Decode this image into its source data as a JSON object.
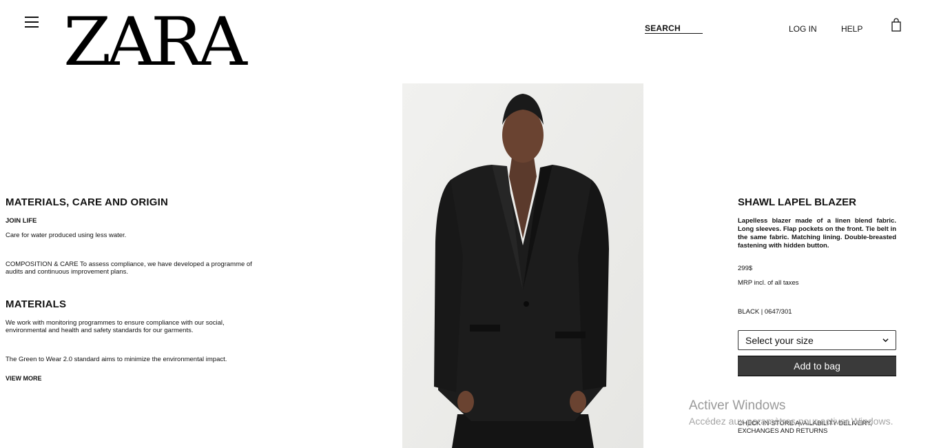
{
  "header": {
    "logo_text": "ZARA",
    "search_label": "SEARCH",
    "login_label": "LOG IN",
    "help_label": "HELP",
    "icons": {
      "menu": "menu-icon",
      "bag": "shopping-bag-icon"
    }
  },
  "left": {
    "section1_title": "MATERIALS, CARE AND ORIGIN",
    "join_life": "JOIN LIFE",
    "care_water": "Care for water produced using less water.",
    "composition_line1": "COMPOSITION & CARE To assess compliance, we have developed a programme of",
    "composition_line2": "audits and continuous improvement plans.",
    "section2_title": "MATERIALS",
    "monitoring_line1": "We work with monitoring programmes to ensure compliance with our social,",
    "monitoring_line2": "environmental and health and safety standards for our garments.",
    "green_to_wear": "The Green to Wear 2.0 standard aims to minimize the environmental impact.",
    "view_more": "VIEW MORE"
  },
  "product": {
    "title": "SHAWL LAPEL BLAZER",
    "description": "Lapelless blazer made of a linen blend fabric. Long sleeves. Flap pockets on the front. Tie belt in the same fabric. Matching lining. Double-breasted fastening with hidden button.",
    "price": "299$",
    "tax_note": "MRP incl. of all taxes",
    "color_ref": "BLACK | 0647/301",
    "size_select": "Select your size",
    "add_to_bag": "Add to bag",
    "check_line1": "CHECK IN-STORE AVAILABILITY DELIVERY,",
    "check_line2": "EXCHANGES AND RETURNS"
  },
  "watermark": {
    "line1": "Activer Windows",
    "line2": "Accédez aux paramètres pour activer Windows."
  },
  "colors": {
    "button_bg": "#3a3a3a",
    "text": "#111111"
  }
}
